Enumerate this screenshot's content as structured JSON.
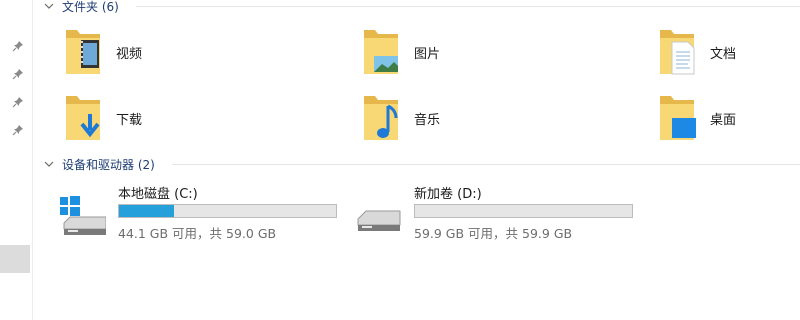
{
  "folders_section": {
    "title": "文件夹 (6)",
    "items": [
      {
        "label": "视频",
        "icon": "video-folder-icon"
      },
      {
        "label": "图片",
        "icon": "pictures-folder-icon"
      },
      {
        "label": "文档",
        "icon": "documents-folder-icon"
      },
      {
        "label": "下载",
        "icon": "downloads-folder-icon"
      },
      {
        "label": "音乐",
        "icon": "music-folder-icon"
      },
      {
        "label": "桌面",
        "icon": "desktop-folder-icon"
      }
    ]
  },
  "devices_section": {
    "title": "设备和驱动器 (2)",
    "drives": [
      {
        "name": "本地磁盘 (C:)",
        "free_text": "44.1 GB 可用，共 59.0 GB",
        "used_fraction": 0.253,
        "icon": "windows-system-drive-icon"
      },
      {
        "name": "新加卷 (D:)",
        "free_text": "59.9 GB 可用，共 59.9 GB",
        "used_fraction": 0.0,
        "icon": "hard-drive-icon"
      }
    ]
  },
  "colors": {
    "section_title": "#1e3d73",
    "usage_bar_fill": "#26a0da",
    "folder_yellow": "#f8d775",
    "folder_yellow_dark": "#e6b84b"
  }
}
